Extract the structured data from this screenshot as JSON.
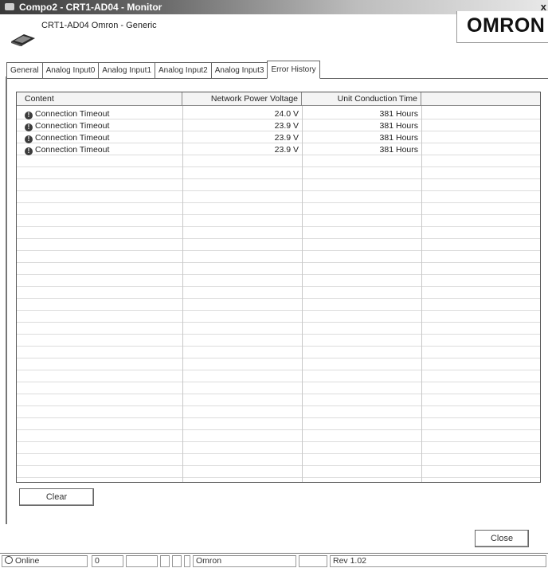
{
  "window": {
    "title": "Compo2 - CRT1-AD04 - Monitor",
    "close_glyph": "x"
  },
  "device": {
    "name": "CRT1-AD04  Omron - Generic",
    "icon": "device-module-icon"
  },
  "logo": {
    "text": "OMRON"
  },
  "tabs": [
    {
      "label": "General"
    },
    {
      "label": "Analog Input0"
    },
    {
      "label": "Analog Input1"
    },
    {
      "label": "Analog Input2"
    },
    {
      "label": "Analog Input3"
    },
    {
      "label": "Error History"
    }
  ],
  "active_tab": "Error History",
  "table": {
    "columns": [
      "Content",
      "Network Power Voltage",
      "Unit Conduction Time"
    ],
    "rows": [
      {
        "content": "Connection Timeout",
        "voltage": "24.0 V",
        "time": "381 Hours",
        "icon": "error-icon"
      },
      {
        "content": "Connection Timeout",
        "voltage": "23.9 V",
        "time": "381 Hours",
        "icon": "error-icon"
      },
      {
        "content": "Connection Timeout",
        "voltage": "23.9 V",
        "time": "381 Hours",
        "icon": "error-icon"
      },
      {
        "content": "Connection Timeout",
        "voltage": "23.9 V",
        "time": "381 Hours",
        "icon": "error-icon"
      }
    ]
  },
  "buttons": {
    "clear": "Clear",
    "close": "Close"
  },
  "statusbar": {
    "online": "Online",
    "counter": "0",
    "vendor": "Omron",
    "revision": "Rev 1.02"
  }
}
